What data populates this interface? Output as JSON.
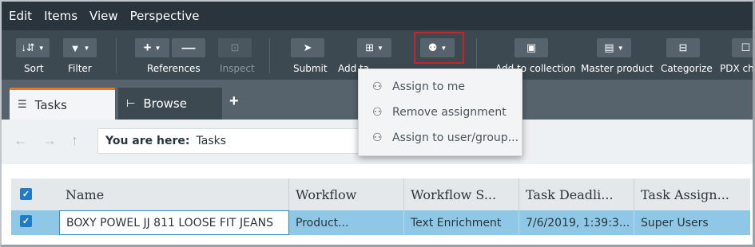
{
  "menubar": {
    "items": [
      "Edit",
      "Items",
      "View",
      "Perspective"
    ]
  },
  "toolbar": {
    "sort_label": "Sort",
    "filter_label": "Filter",
    "references_label": "References",
    "inspect_label": "Inspect",
    "submit_label": "Submit",
    "add_label": "Add ta",
    "collection_label": "Add to collection",
    "master_product_label": "Master product",
    "categorize_label": "Categorize",
    "pdx_label": "PDX cha"
  },
  "dropdown": {
    "items": [
      "Assign to me",
      "Remove assignment",
      "Assign to user/group..."
    ]
  },
  "tabs": [
    {
      "label": "Tasks"
    },
    {
      "label": "Browse"
    }
  ],
  "add_tab_symbol": "+",
  "breadcrumb": {
    "label": "You are here:",
    "value": "Tasks"
  },
  "table": {
    "columns": [
      "Name",
      "Workflow",
      "Workflow S...",
      "Task Deadli...",
      "Task Assign..."
    ],
    "rows": [
      {
        "name": "BOXY POWEL JJ 811 LOOSE FIT JEANS",
        "workflow": "Product...",
        "workflow_state": "Text Enrichment",
        "deadline": "7/6/2019, 1:39:3...",
        "assignee": "Super Users"
      }
    ]
  },
  "colors": {
    "menubar": "#2a343c",
    "toolbar": "#3d4951",
    "active_tab_accent": "#e87722",
    "selection_row": "#8fc8e6",
    "checkbox": "#1e7cc9",
    "highlight": "#c0272d"
  }
}
